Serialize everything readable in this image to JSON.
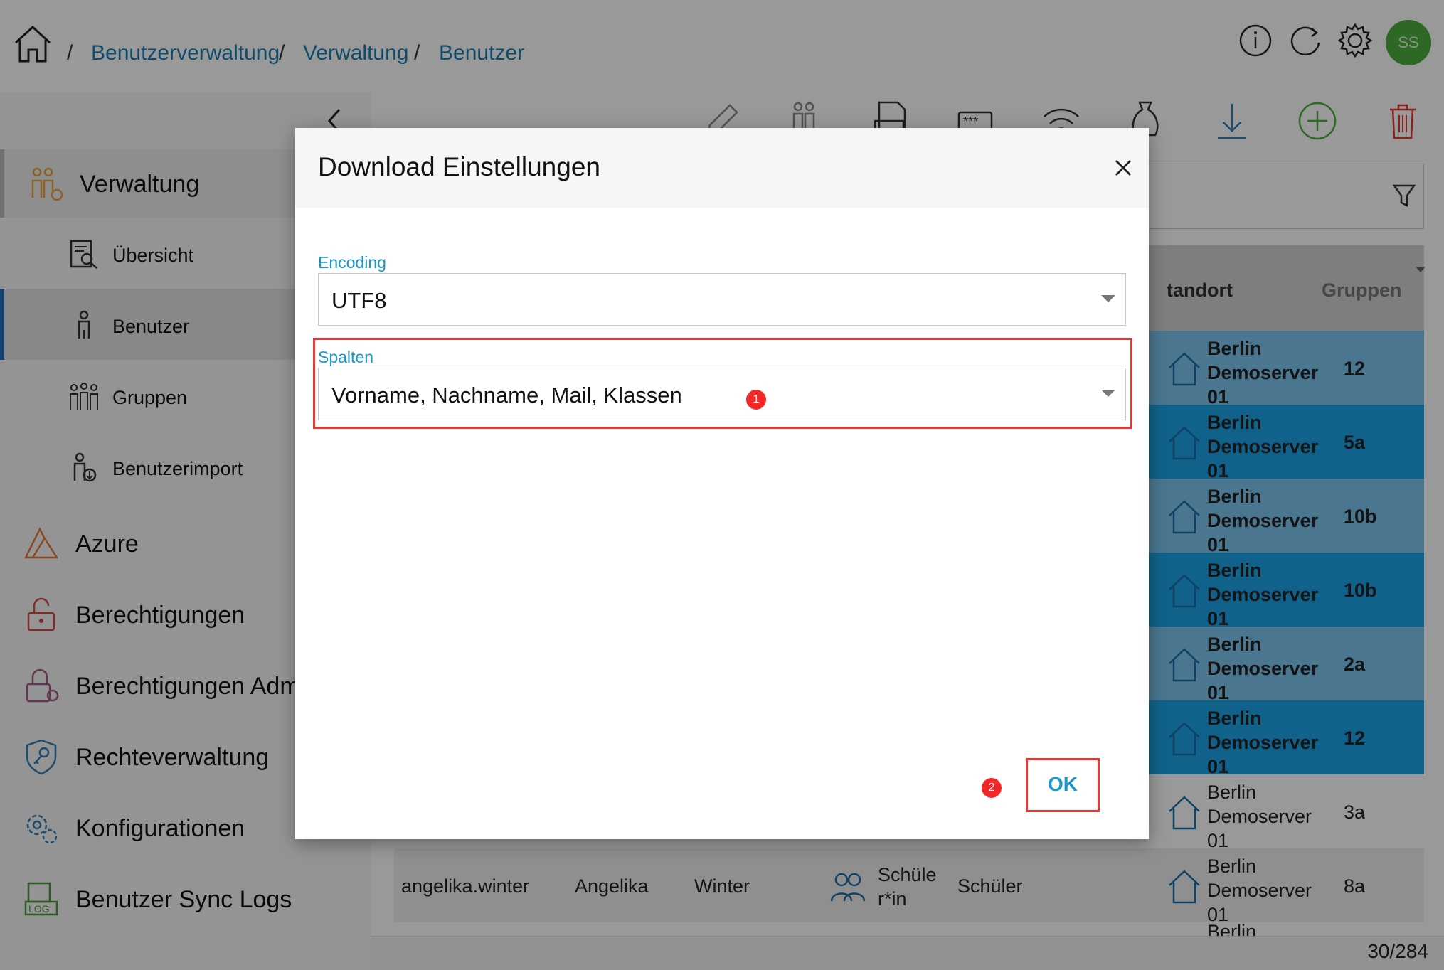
{
  "header": {
    "breadcrumb": [
      "Benutzerverwaltung",
      "Verwaltung",
      "Benutzer"
    ],
    "separator": "/",
    "avatar_initials": "SS",
    "icons": [
      "home-icon",
      "info-icon",
      "refresh-icon",
      "gear-icon"
    ]
  },
  "sidebar": {
    "sections": {
      "verwaltung": "Verwaltung",
      "azure": "Azure",
      "berechtigungen": "Berechtigungen",
      "berechtigungen_admin": "Berechtigungen Admin",
      "rechteverwaltung": "Rechteverwaltung",
      "konfigurationen": "Konfigurationen",
      "sync_logs": "Benutzer Sync Logs"
    },
    "subitems": {
      "uebersicht": "Übersicht",
      "benutzer": "Benutzer",
      "gruppen": "Gruppen",
      "benutzerimport": "Benutzerimport"
    }
  },
  "toolbar": {
    "icons": [
      "edit-icon",
      "group-users-icon",
      "pdf-icon",
      "password-icon",
      "wifi-icon",
      "budget-icon",
      "download-icon",
      "add-icon",
      "delete-icon"
    ]
  },
  "table": {
    "headers": {
      "standort": "tandort",
      "gruppen": "Gruppen"
    },
    "rows": [
      {
        "loc1": "Berlin",
        "loc2": "Demoserver",
        "loc3": "01",
        "group": "12"
      },
      {
        "loc1": "Berlin",
        "loc2": "Demoserver",
        "loc3": "01",
        "group": "5a"
      },
      {
        "loc1": "Berlin",
        "loc2": "Demoserver",
        "loc3": "01",
        "group": "10b"
      },
      {
        "loc1": "Berlin",
        "loc2": "Demoserver",
        "loc3": "01",
        "group": "10b"
      },
      {
        "loc1": "Berlin",
        "loc2": "Demoserver",
        "loc3": "01",
        "group": "2a"
      },
      {
        "loc1": "Berlin",
        "loc2": "Demoserver",
        "loc3": "01",
        "group": "12"
      },
      {
        "loc1": "Berlin",
        "loc2": "Demoserver",
        "loc3": "01",
        "group": "3a"
      },
      {
        "username": "angelika.winter",
        "firstname": "Angelika",
        "lastname": "Winter",
        "type1": "Schüle",
        "type2": "r*in",
        "role": "Schüler",
        "loc1": "Berlin",
        "loc2": "Demoserver",
        "loc3": "01",
        "group": "8a"
      },
      {
        "loc1": "Berlin"
      }
    ],
    "pager": "30/284"
  },
  "dialog": {
    "title": "Download Einstellungen",
    "encoding": {
      "label": "Encoding",
      "value": "UTF8"
    },
    "spalten": {
      "label": "Spalten",
      "value": "Vorname, Nachname, Mail, Klassen"
    },
    "ok_label": "OK",
    "markers": [
      "1",
      "2"
    ]
  },
  "colors": {
    "accent": "#1a96c8",
    "highlight": "#e53935",
    "avatar": "#4caf3d",
    "row_selected_light": "#7cc6ef",
    "row_selected_dark": "#1da3e8"
  }
}
